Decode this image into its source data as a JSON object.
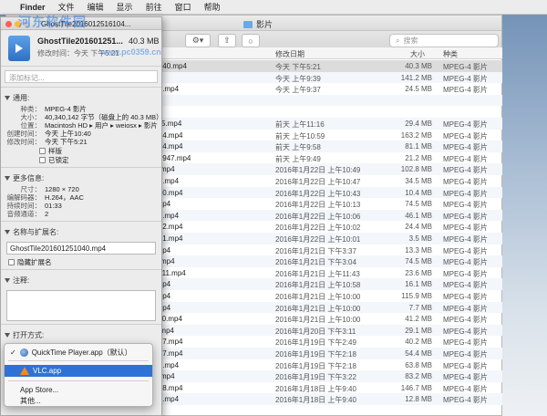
{
  "menubar": {
    "apple": "",
    "app": "Finder",
    "items": [
      "文件",
      "编辑",
      "显示",
      "前往",
      "窗口",
      "帮助"
    ]
  },
  "finder": {
    "title": "影片",
    "search_placeholder": "搜索",
    "columns": {
      "date": "修改日期",
      "size": "大小",
      "kind": "种类"
    },
    "rows": [
      {
        "name": "1251040.mp4",
        "date": "今天 下午5:21",
        "size": "40.3 MB",
        "kind": "MPEG-4 影片"
      },
      {
        "name": "n.mp4",
        "date": "今天 上午9:39",
        "size": "141.2 MB",
        "kind": "MPEG-4 影片"
      },
      {
        "name": "50934.mp4",
        "date": "今天 上午9:37",
        "size": "24.5 MB",
        "kind": "MPEG-4 影片"
      },
      {
        "name": "",
        "date": "",
        "size": "",
        "kind": ""
      },
      {
        "name": "",
        "date": "",
        "size": "",
        "kind": ""
      },
      {
        "name": "231115.mp4",
        "date": "前天 上午11:16",
        "size": "29.4 MB",
        "kind": "MPEG-4 影片"
      },
      {
        "name": "231044.mp4",
        "date": "前天 上午10:59",
        "size": "163.2 MB",
        "kind": "MPEG-4 影片"
      },
      {
        "name": "230954.mp4",
        "date": "前天 上午9:58",
        "size": "81.1 MB",
        "kind": "MPEG-4 影片"
      },
      {
        "name": "01230947.mp4",
        "date": "前天 上午9:49",
        "size": "21.2 MB",
        "kind": "MPEG-4 影片"
      },
      {
        "name": "1031.mp4",
        "date": "2016年1月22日 上午10:49",
        "size": "102.8 MB",
        "kind": "MPEG-4 影片"
      },
      {
        "name": "21045.mp4",
        "date": "2016年1月22日 上午10:47",
        "size": "34.5 MB",
        "kind": "MPEG-4 影片"
      },
      {
        "name": "221030.mp4",
        "date": "2016年1月22日 上午10:43",
        "size": "10.4 MB",
        "kind": "MPEG-4 影片"
      },
      {
        "name": "002.mp4",
        "date": "2016年1月22日 上午10:13",
        "size": "74.5 MB",
        "kind": "MPEG-4 影片"
      },
      {
        "name": "21003.mp4",
        "date": "2016年1月22日 上午10:06",
        "size": "46.1 MB",
        "kind": "MPEG-4 影片"
      },
      {
        "name": "221002.mp4",
        "date": "2016年1月22日 上午10:02",
        "size": "24.4 MB",
        "kind": "MPEG-4 影片"
      },
      {
        "name": "221001.mp4",
        "date": "2016年1月22日 上午10:01",
        "size": "3.5 MB",
        "kind": "MPEG-4 影片"
      },
      {
        "name": "537.mp4",
        "date": "2016年1月21日 下午3:37",
        "size": "13.3 MB",
        "kind": "MPEG-4 影片"
      },
      {
        "name": "1502.mp4",
        "date": "2016年1月21日 下午3:04",
        "size": "74.5 MB",
        "kind": "MPEG-4 影片"
      },
      {
        "name": "0211411.mp4",
        "date": "2016年1月21日 上午11:43",
        "size": "23.6 MB",
        "kind": "MPEG-4 影片"
      },
      {
        "name": "057.mp4",
        "date": "2016年1月21日 上午10:58",
        "size": "16.1 MB",
        "kind": "MPEG-4 影片"
      },
      {
        "name": "000.mp4",
        "date": "2016年1月21日 上午10:00",
        "size": "115.9 MB",
        "kind": "MPEG-4 影片"
      },
      {
        "name": "000.mp4",
        "date": "2016年1月21日 上午10:00",
        "size": "7.7 MB",
        "kind": "MPEG-4 影片"
      },
      {
        "name": "211000.mp4",
        "date": "2016年1月21日 上午10:00",
        "size": "41.2 MB",
        "kind": "MPEG-4 影片"
      },
      {
        "name": "1511.mp4",
        "date": "2016年1月20日 下午3:11",
        "size": "29.1 MB",
        "kind": "MPEG-4 影片"
      },
      {
        "name": "191447.mp4",
        "date": "2016年1月19日 下午2:49",
        "size": "40.2 MB",
        "kind": "MPEG-4 影片"
      },
      {
        "name": "191417.mp4",
        "date": "2016年1月19日 下午2:18",
        "size": "54.4 MB",
        "kind": "MPEG-4 影片"
      },
      {
        "name": "91417.mp4",
        "date": "2016年1月19日 下午2:18",
        "size": "63.8 MB",
        "kind": "MPEG-4 影片"
      },
      {
        "name": "1520.mp4",
        "date": "2016年1月19日 下午3:22",
        "size": "83.2 MB",
        "kind": "MPEG-4 影片"
      },
      {
        "name": "180938.mp4",
        "date": "2016年1月18日 上午9:40",
        "size": "146.7 MB",
        "kind": "MPEG-4 影片"
      },
      {
        "name": "80937.mp4",
        "date": "2016年1月18日 上午9:40",
        "size": "12.8 MB",
        "kind": "MPEG-4 影片"
      }
    ]
  },
  "info": {
    "title": "GhostTile2016012516104...",
    "file_name": "GhostTile201601251...",
    "file_size": "40.3 MB",
    "modified_line": "修改时间：今天 下午5:21",
    "tag_placeholder": "添加标记...",
    "general": {
      "title": "通用:",
      "fields": [
        {
          "k": "种类：",
          "v": "MPEG-4 影片"
        },
        {
          "k": "大小：",
          "v": "40,340,142 字节（磁盘上的 40.3 MB）"
        },
        {
          "k": "位置：",
          "v": "Macintosh HD ▸ 用户 ▸ weiosx ▸ 影片"
        },
        {
          "k": "创建时间：",
          "v": "今天 上午10:40"
        },
        {
          "k": "修改时间：",
          "v": "今天 下午5:21"
        }
      ],
      "check_template": "样版",
      "check_locked": "已锁定"
    },
    "more": {
      "title": "更多信息:",
      "fields": [
        {
          "k": "尺寸：",
          "v": "1280 × 720"
        },
        {
          "k": "编解码器：",
          "v": "H.264，AAC"
        },
        {
          "k": "持续时间：",
          "v": "01:33"
        },
        {
          "k": "音频通道：",
          "v": "2"
        }
      ]
    },
    "name_ext": {
      "title": "名称与扩展名:",
      "value": "GhostTile201601251040.mp4",
      "hide_ext": "隐藏扩展名"
    },
    "comments": {
      "title": "注释:"
    },
    "open_with": {
      "title": "打开方式:"
    }
  },
  "popup": {
    "items": [
      "QuickTime Player.app（默认）",
      "VLC.app",
      "App Store...",
      "其他..."
    ],
    "checked": "✓"
  },
  "watermark": {
    "text": "河东软件园",
    "url": "www.pc0359.cn"
  }
}
